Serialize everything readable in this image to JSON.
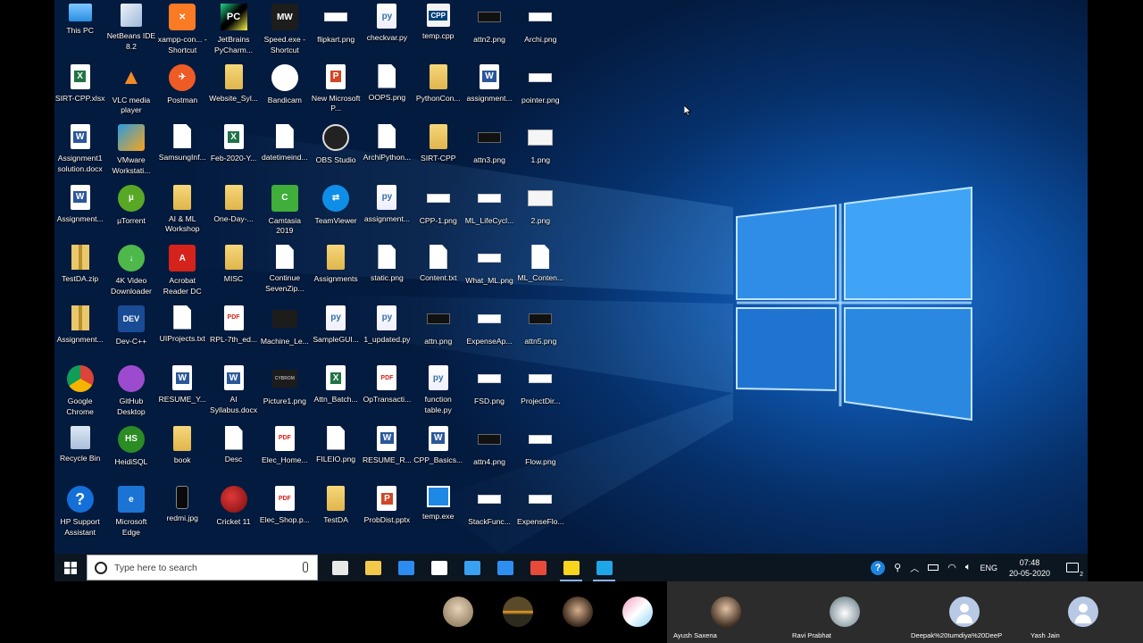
{
  "desktop": {
    "icons": [
      {
        "label": "This PC",
        "kind": "t-pc",
        "glyph": ""
      },
      {
        "label": "SIRT-CPP.xlsx",
        "kind": "t-excel",
        "glyph": "X"
      },
      {
        "label": "Assignment1 solution.docx",
        "kind": "t-word",
        "glyph": "W"
      },
      {
        "label": "Assignment...",
        "kind": "t-word",
        "glyph": "W"
      },
      {
        "label": "TestDA.zip",
        "kind": "t-zip",
        "glyph": ""
      },
      {
        "label": "Assignment...",
        "kind": "t-zip",
        "glyph": ""
      },
      {
        "label": "Google Chrome",
        "kind": "t-chrome",
        "glyph": ""
      },
      {
        "label": "Recycle Bin",
        "kind": "t-recycle",
        "glyph": ""
      },
      {
        "label": "HP Support Assistant",
        "kind": "t-help",
        "glyph": "?"
      },
      {
        "label": "NetBeans IDE 8.2",
        "kind": "t-cube",
        "glyph": ""
      },
      {
        "label": "VLC media player",
        "kind": "t-vlc",
        "glyph": "▲"
      },
      {
        "label": "VMware Workstati...",
        "kind": "t-vmware",
        "glyph": ""
      },
      {
        "label": "µTorrent",
        "kind": "t-utor",
        "glyph": "µ"
      },
      {
        "label": "4K Video Downloader",
        "kind": "t-4k",
        "glyph": "↓"
      },
      {
        "label": "Dev-C++",
        "kind": "t-devcpp",
        "glyph": "DEV"
      },
      {
        "label": "GitHub Desktop",
        "kind": "t-github",
        "glyph": ""
      },
      {
        "label": "HeidiSQL",
        "kind": "t-heidi",
        "glyph": "HS"
      },
      {
        "label": "Microsoft Edge",
        "kind": "t-edge",
        "glyph": "e"
      },
      {
        "label": "xampp-con... - Shortcut",
        "kind": "t-xampp",
        "glyph": "✕"
      },
      {
        "label": "Postman",
        "kind": "t-postman",
        "glyph": "✈"
      },
      {
        "label": "SamsungInf...",
        "kind": "t-file",
        "glyph": ""
      },
      {
        "label": "AI & ML Workshop",
        "kind": "t-folder",
        "glyph": ""
      },
      {
        "label": "Acrobat Reader DC",
        "kind": "t-acrobat",
        "glyph": "A"
      },
      {
        "label": "UIProjects.txt",
        "kind": "t-file",
        "glyph": ""
      },
      {
        "label": "RESUME_Y...",
        "kind": "t-word",
        "glyph": "W"
      },
      {
        "label": "book",
        "kind": "t-folder",
        "glyph": ""
      },
      {
        "label": "redmi.jpg",
        "kind": "t-phone",
        "glyph": ""
      },
      {
        "label": "JetBrains PyCharm...",
        "kind": "t-pycharm",
        "glyph": "PC"
      },
      {
        "label": "Website_Syl...",
        "kind": "t-folder",
        "glyph": ""
      },
      {
        "label": "Feb-2020-Y...",
        "kind": "t-excel",
        "glyph": "X"
      },
      {
        "label": "One-Day-...",
        "kind": "t-folder",
        "glyph": ""
      },
      {
        "label": "MISC",
        "kind": "t-folder",
        "glyph": ""
      },
      {
        "label": "RPL-7th_ed...",
        "kind": "t-pdf",
        "glyph": "PDF"
      },
      {
        "label": "AI Syllabus.docx",
        "kind": "t-word",
        "glyph": "W"
      },
      {
        "label": "Desc",
        "kind": "t-file",
        "glyph": ""
      },
      {
        "label": "Cricket 11",
        "kind": "t-cricket",
        "glyph": ""
      },
      {
        "label": "Speed.exe - Shortcut",
        "kind": "t-mw",
        "glyph": "MW"
      },
      {
        "label": "Bandicam",
        "kind": "t-bandi",
        "glyph": "●"
      },
      {
        "label": "datetimeind...",
        "kind": "t-file",
        "glyph": ""
      },
      {
        "label": "Camtasia 2019",
        "kind": "t-camtasia",
        "glyph": "C"
      },
      {
        "label": "Continue SevenZip...",
        "kind": "t-file",
        "glyph": ""
      },
      {
        "label": "Machine_Le...",
        "kind": "t-cybrom",
        "glyph": ""
      },
      {
        "label": "Picture1.png",
        "kind": "t-cybrom",
        "glyph": "CYBROM"
      },
      {
        "label": "Elec_Home...",
        "kind": "t-pdf",
        "glyph": "PDF"
      },
      {
        "label": "Elec_Shop.p...",
        "kind": "t-pdf",
        "glyph": "PDF"
      },
      {
        "label": "flipkart.png",
        "kind": "t-img",
        "glyph": ""
      },
      {
        "label": "New Microsoft P...",
        "kind": "t-ppt",
        "glyph": "P"
      },
      {
        "label": "OBS Studio",
        "kind": "t-obs",
        "glyph": ""
      },
      {
        "label": "TeamViewer",
        "kind": "t-teamv",
        "glyph": "⇄"
      },
      {
        "label": "Assignments",
        "kind": "t-folder",
        "glyph": ""
      },
      {
        "label": "SampleGUI...",
        "kind": "t-py",
        "glyph": "py"
      },
      {
        "label": "Attn_Batch...",
        "kind": "t-excel",
        "glyph": "X"
      },
      {
        "label": "FILEIO.png",
        "kind": "t-file",
        "glyph": ""
      },
      {
        "label": "TestDA",
        "kind": "t-folder",
        "glyph": ""
      },
      {
        "label": "checkvar.py",
        "kind": "t-py",
        "glyph": "py"
      },
      {
        "label": "OOPS.png",
        "kind": "t-file",
        "glyph": ""
      },
      {
        "label": "ArchiPython...",
        "kind": "t-file",
        "glyph": ""
      },
      {
        "label": "assignment...",
        "kind": "t-py",
        "glyph": "py"
      },
      {
        "label": "static.png",
        "kind": "t-file",
        "glyph": ""
      },
      {
        "label": "1_updated.py",
        "kind": "t-py",
        "glyph": "py"
      },
      {
        "label": "OpTransacti...",
        "kind": "t-pdf",
        "glyph": "PDF"
      },
      {
        "label": "RESUME_R...",
        "kind": "t-word",
        "glyph": "W"
      },
      {
        "label": "ProbDist.pptx",
        "kind": "t-ppt",
        "glyph": "P"
      },
      {
        "label": "temp.cpp",
        "kind": "t-cpp",
        "glyph": "CPP"
      },
      {
        "label": "PythonCon...",
        "kind": "t-folder",
        "glyph": ""
      },
      {
        "label": "SIRT-CPP",
        "kind": "t-folder",
        "glyph": ""
      },
      {
        "label": "CPP-1.png",
        "kind": "t-img",
        "glyph": ""
      },
      {
        "label": "Content.txt",
        "kind": "t-file",
        "glyph": ""
      },
      {
        "label": "attn.png",
        "kind": "t-img-dark",
        "glyph": ""
      },
      {
        "label": "function table.py",
        "kind": "t-py",
        "glyph": "py"
      },
      {
        "label": "CPP_Basics...",
        "kind": "t-word",
        "glyph": "W"
      },
      {
        "label": "temp.exe",
        "kind": "t-ex",
        "glyph": ""
      },
      {
        "label": "attn2.png",
        "kind": "t-img-dark",
        "glyph": ""
      },
      {
        "label": "assignment...",
        "kind": "t-word",
        "glyph": "W"
      },
      {
        "label": "attn3.png",
        "kind": "t-img-dark",
        "glyph": ""
      },
      {
        "label": "ML_LifeCycl...",
        "kind": "t-img",
        "glyph": ""
      },
      {
        "label": "What_ML.png",
        "kind": "t-img",
        "glyph": ""
      },
      {
        "label": "ExpenseAp...",
        "kind": "t-img",
        "glyph": ""
      },
      {
        "label": "FSD.png",
        "kind": "t-img",
        "glyph": ""
      },
      {
        "label": "attn4.png",
        "kind": "t-img-dark",
        "glyph": ""
      },
      {
        "label": "StackFunc...",
        "kind": "t-img",
        "glyph": ""
      },
      {
        "label": "Archi.png",
        "kind": "t-img",
        "glyph": ""
      },
      {
        "label": "pointer.png",
        "kind": "t-img",
        "glyph": ""
      },
      {
        "label": "1.png",
        "kind": "t-scr",
        "glyph": ""
      },
      {
        "label": "2.png",
        "kind": "t-scr",
        "glyph": ""
      },
      {
        "label": "ML_Conten...",
        "kind": "t-file",
        "glyph": ""
      },
      {
        "label": "attn5.png",
        "kind": "t-img-dark",
        "glyph": ""
      },
      {
        "label": "ProjectDir...",
        "kind": "t-img",
        "glyph": ""
      },
      {
        "label": "Flow.png",
        "kind": "t-img",
        "glyph": ""
      },
      {
        "label": "ExpenseFlo...",
        "kind": "t-img",
        "glyph": ""
      }
    ]
  },
  "taskbar": {
    "search_placeholder": "Type here to search",
    "pinned": [
      {
        "name": "store-icon",
        "color": "#e8e8e8",
        "active": false
      },
      {
        "name": "file-explorer-icon",
        "color": "#f3c94b",
        "active": false
      },
      {
        "name": "edge-icon",
        "color": "#2c8cf0",
        "active": false
      },
      {
        "name": "dropbox-icon",
        "color": "#ffffff",
        "active": false
      },
      {
        "name": "vscode-icon",
        "color": "#3aa0f0",
        "active": false
      },
      {
        "name": "mail-icon",
        "color": "#2f8ff0",
        "active": false
      },
      {
        "name": "chrome-icon",
        "color": "#e84a3a",
        "active": false
      },
      {
        "name": "sticky-notes-icon",
        "color": "#f7d51d",
        "active": true
      },
      {
        "name": "skype-icon",
        "color": "#1ea6e8",
        "active": true
      }
    ],
    "language": "ENG",
    "time": "07:48",
    "date": "20-05-2020",
    "notification_count": "2"
  },
  "meeting": {
    "participants": [
      {
        "name": "Ayush Saxena"
      },
      {
        "name": "Ravi Prabhat"
      },
      {
        "name": "Deepak%20tumdiya%20DeeP"
      },
      {
        "name": "Yash Jain"
      }
    ]
  },
  "colors": {
    "accent": "#0078d7",
    "taskbar": "#0b1620",
    "wallpaper_dark": "#041b40",
    "wallpaper_light": "#1d6fd0"
  }
}
